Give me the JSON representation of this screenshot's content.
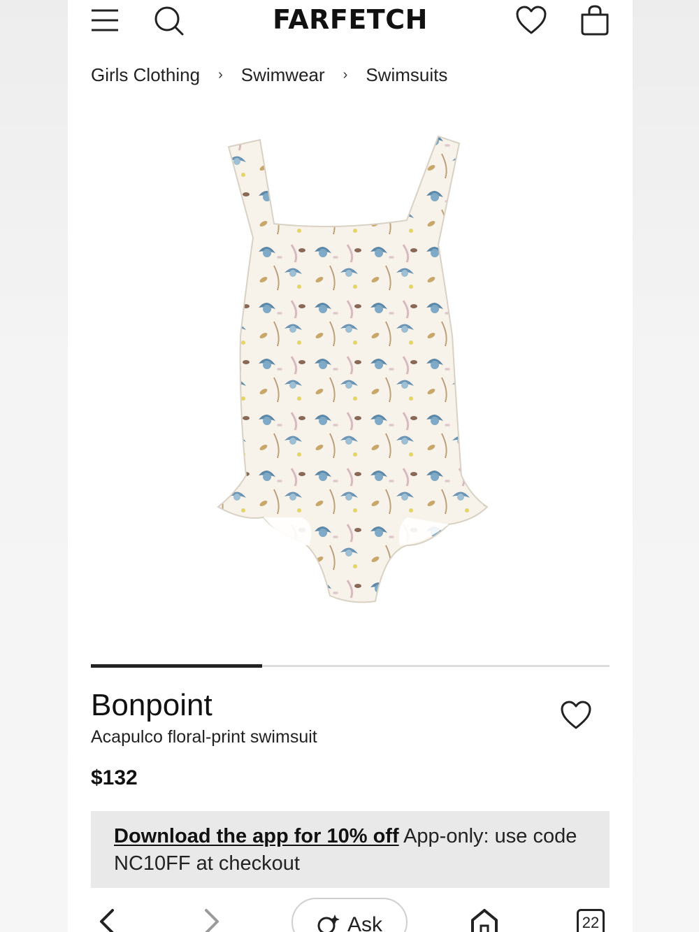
{
  "header": {
    "logo": "FARFETCH",
    "icons": [
      "menu-icon",
      "search-icon",
      "heart-icon",
      "bag-icon"
    ]
  },
  "breadcrumb": [
    {
      "label": "Girls Clothing"
    },
    {
      "label": "Swimwear"
    },
    {
      "label": "Swimsuits"
    }
  ],
  "gallery": {
    "image": "floral-print one-piece swimsuit",
    "progress": 0.33
  },
  "product": {
    "brand": "Bonpoint",
    "name": "Acapulco floral-print swimsuit",
    "price": "$132"
  },
  "promo": {
    "link_text": "Download the app for 10% off",
    "text": " App-only: use code NC10FF at checkout"
  },
  "browser_bar": {
    "ask_label": "Ask",
    "tab_count": "22",
    "icons": [
      "back-icon",
      "forward-icon",
      "ask-sparkle-icon",
      "home-icon",
      "tabs-icon"
    ]
  },
  "colors": {
    "text": "#222222",
    "promo_bg": "#e9e9e9",
    "progress_fill": "#222222",
    "progress_track": "#dcdcdc"
  }
}
